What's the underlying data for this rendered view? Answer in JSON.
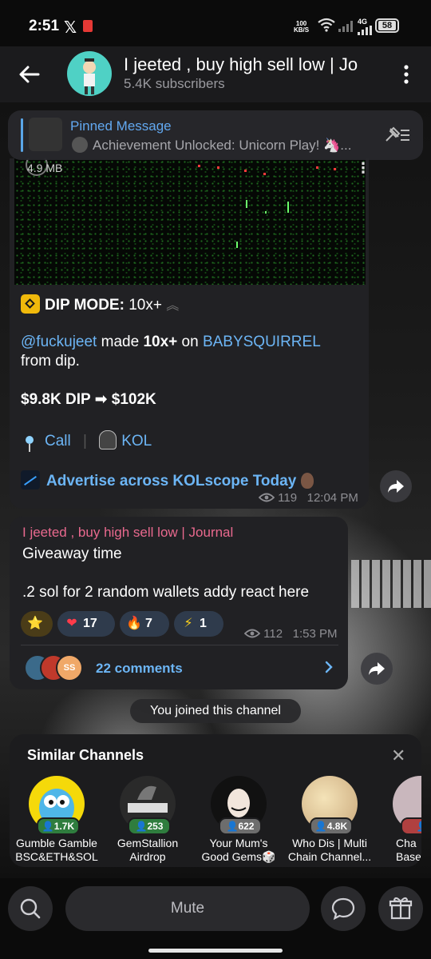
{
  "status": {
    "time": "2:51",
    "x_label": "𝕏",
    "net_speed_top": "100",
    "net_speed_bottom": "KB/S",
    "network": "4G",
    "battery": "58"
  },
  "header": {
    "title": "I jeeted , buy high sell low | Jo",
    "subscribers": "5.4K subscribers"
  },
  "pinned": {
    "label": "Pinned Message",
    "text": "Achievement Unlocked: Unicorn Play! 🦄..."
  },
  "message1": {
    "video_size": "4.9 MB",
    "dip_label": "DIP MODE:",
    "dip_value": " 10x+",
    "user": "@fuckujeet",
    "made_text": " made ",
    "multiplier": "10x+",
    "on_text": " on ",
    "token": "BABYSQUIRREL",
    "from_text": "from dip.",
    "dip_amount": "$9.8K DIP ➡ $102K",
    "call_label": "Call",
    "kol_label": "KOL",
    "advertise": "Advertise across KOLscope Today",
    "views": "119",
    "time": "12:04 PM"
  },
  "message2": {
    "author": "I jeeted , buy high sell low | Journal",
    "line1": "Giveaway time",
    "line2": ".2 sol for 2 random wallets addy react here",
    "reactions": [
      {
        "emoji": "⭐",
        "count": ""
      },
      {
        "emoji": "❤",
        "count": "17"
      },
      {
        "emoji": "🔥",
        "count": "7"
      },
      {
        "emoji": "⚡",
        "count": "1"
      }
    ],
    "views": "112",
    "time": "1:53 PM",
    "comments": "22 comments",
    "avatar_last_text": "SS"
  },
  "joined_notice": "You joined this channel",
  "similar": {
    "title": "Similar Channels",
    "channels": [
      {
        "name": "Gumble Gamble BSC&ETH&SOL",
        "count": "1.7K",
        "color": "#f5d90a"
      },
      {
        "name": "GemStallion Airdrop",
        "count": "253",
        "color": "#2a2a2a"
      },
      {
        "name": "Your Mum's Good Gems🎲",
        "count": "622",
        "color": "#111111"
      },
      {
        "name": "Who Dis | Multi Chain Channel...",
        "count": "4.8K",
        "color": "#e8d6a8"
      },
      {
        "name": "Cha Base",
        "count": "",
        "color": "#c9b7bd"
      }
    ]
  },
  "bottom": {
    "mute_label": "Mute"
  },
  "colors": {
    "accent": "#6cb5f5",
    "author": "#e9698e",
    "bubble": "#212124"
  }
}
